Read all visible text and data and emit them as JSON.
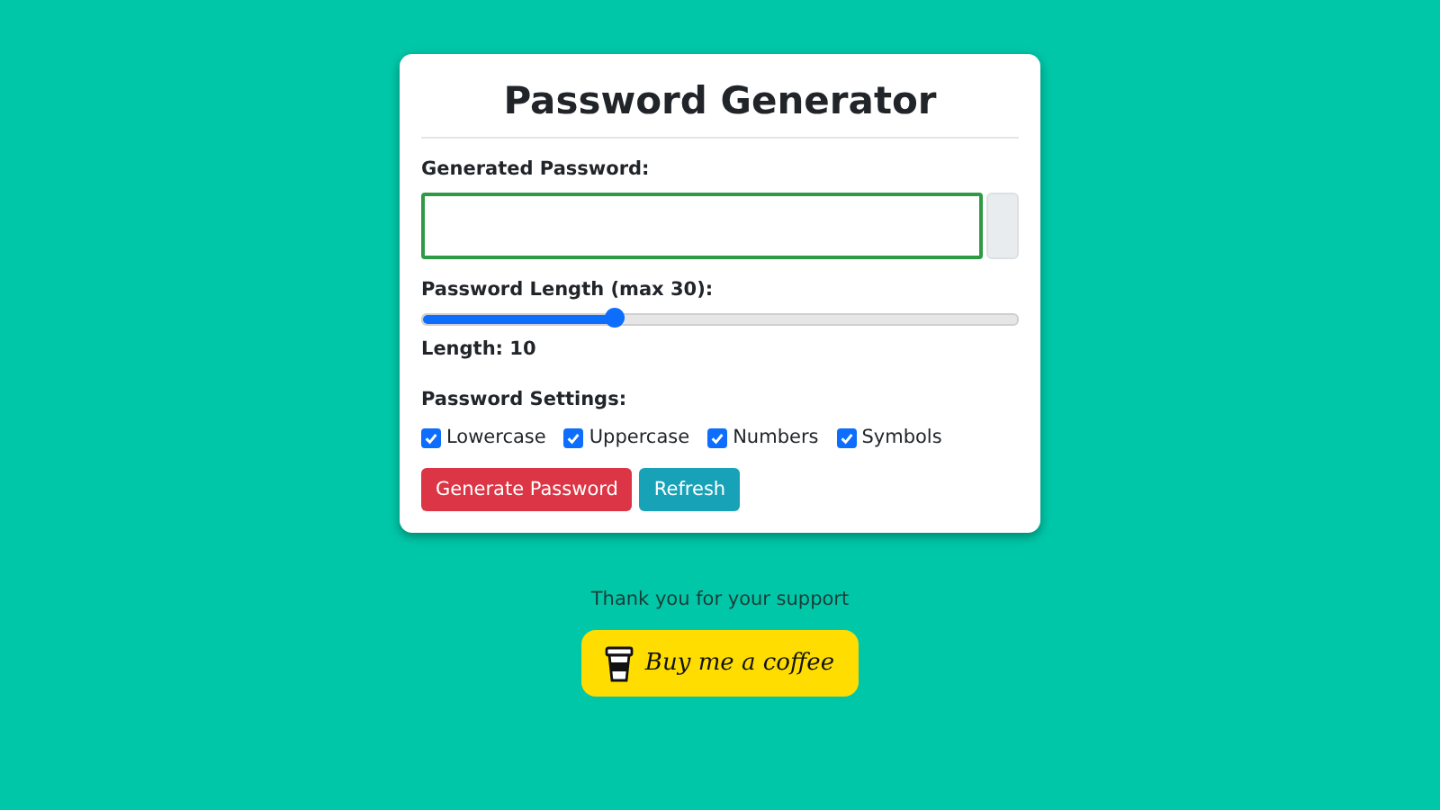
{
  "card": {
    "title": "Password Generator",
    "password_label": "Generated Password:",
    "length_label": "Password Length (max 30):",
    "slider": {
      "level": 0.32
    },
    "length_reading": "Length: 10",
    "settings_label": "Password Settings:",
    "settings": [
      {
        "label": "Lowercase",
        "checked": true
      },
      {
        "label": "Uppercase",
        "checked": true
      },
      {
        "label": "Numbers",
        "checked": true
      },
      {
        "label": "Symbols",
        "checked": true
      }
    ],
    "buttons": [
      {
        "label": "Generate Password",
        "kind": "danger"
      },
      {
        "label": "Refresh",
        "kind": "info"
      }
    ]
  },
  "support": {
    "text": "Thank you for your support",
    "button": "Buy me a coffee"
  }
}
